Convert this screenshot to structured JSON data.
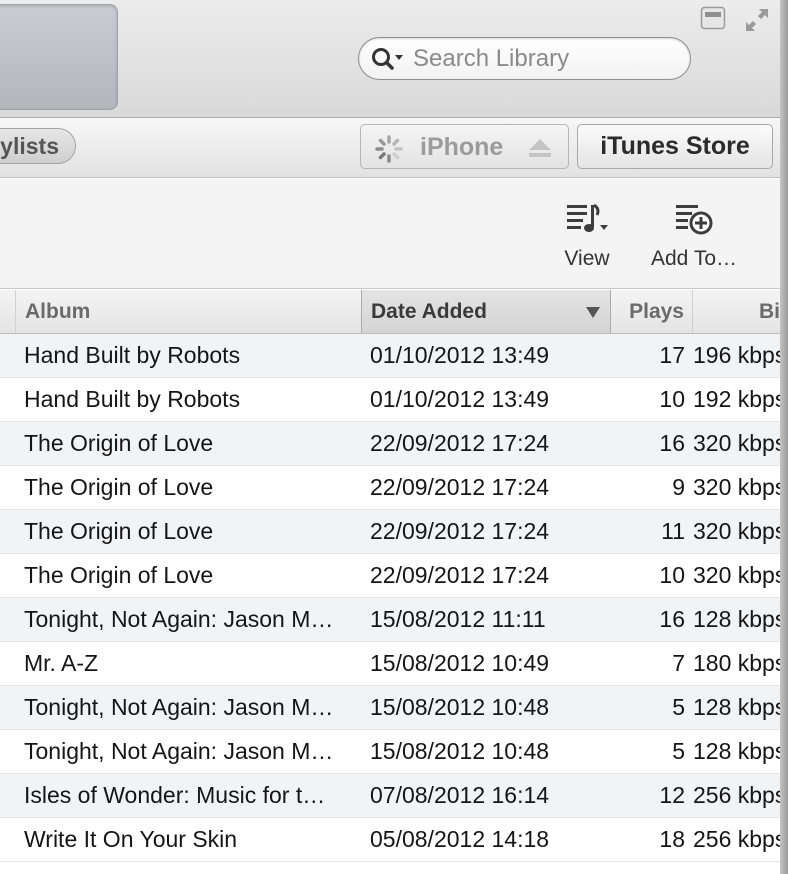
{
  "search": {
    "placeholder": "Search Library"
  },
  "nav": {
    "playlists_label": "ylists",
    "device_label": "iPhone",
    "store_label": "iTunes Store"
  },
  "toolbar": {
    "view_label": "View",
    "add_to_label": "Add To…"
  },
  "table": {
    "headers": {
      "album": "Album",
      "date_added": "Date Added",
      "plays": "Plays",
      "bitrate": "Bi"
    },
    "rows": [
      {
        "album": "Hand Built by Robots",
        "date_added": "01/10/2012 13:49",
        "plays": "17",
        "bitrate": "196 kbps"
      },
      {
        "album": "Hand Built by Robots",
        "date_added": "01/10/2012 13:49",
        "plays": "10",
        "bitrate": "192 kbps"
      },
      {
        "album": "The Origin of Love",
        "date_added": "22/09/2012 17:24",
        "plays": "16",
        "bitrate": "320 kbps"
      },
      {
        "album": "The Origin of Love",
        "date_added": "22/09/2012 17:24",
        "plays": "9",
        "bitrate": "320 kbps"
      },
      {
        "album": "The Origin of Love",
        "date_added": "22/09/2012 17:24",
        "plays": "11",
        "bitrate": "320 kbps"
      },
      {
        "album": "The Origin of Love",
        "date_added": "22/09/2012 17:24",
        "plays": "10",
        "bitrate": "320 kbps"
      },
      {
        "album": "Tonight, Not Again: Jason M…",
        "date_added": "15/08/2012 11:11",
        "plays": "16",
        "bitrate": "128 kbps"
      },
      {
        "album": "Mr. A-Z",
        "date_added": "15/08/2012 10:49",
        "plays": "7",
        "bitrate": "180 kbps"
      },
      {
        "album": "Tonight, Not Again: Jason M…",
        "date_added": "15/08/2012 10:48",
        "plays": "5",
        "bitrate": "128 kbps"
      },
      {
        "album": "Tonight, Not Again: Jason M…",
        "date_added": "15/08/2012 10:48",
        "plays": "5",
        "bitrate": "128 kbps"
      },
      {
        "album": "Isles of Wonder: Music for t…",
        "date_added": "07/08/2012 16:14",
        "plays": "12",
        "bitrate": "256 kbps"
      },
      {
        "album": "Write It On Your Skin",
        "date_added": "05/08/2012 14:18",
        "plays": "18",
        "bitrate": "256 kbps"
      }
    ]
  }
}
